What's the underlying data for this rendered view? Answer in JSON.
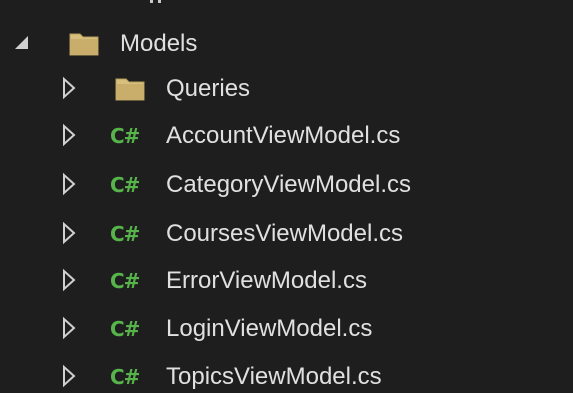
{
  "tree": {
    "root": {
      "label": "Models",
      "expanded": true,
      "icon": "folder-icon"
    },
    "children": [
      {
        "label": "Queries",
        "type": "folder",
        "icon": "folder-icon",
        "expanded": false
      },
      {
        "label": "AccountViewModel.cs",
        "type": "csharp-file",
        "badge": "C#",
        "expanded": false
      },
      {
        "label": "CategoryViewModel.cs",
        "type": "csharp-file",
        "badge": "C#",
        "expanded": false
      },
      {
        "label": "CoursesViewModel.cs",
        "type": "csharp-file",
        "badge": "C#",
        "expanded": false
      },
      {
        "label": "ErrorViewModel.cs",
        "type": "csharp-file",
        "badge": "C#",
        "expanded": false
      },
      {
        "label": "LoginViewModel.cs",
        "type": "csharp-file",
        "badge": "C#",
        "expanded": false
      },
      {
        "label": "TopicsViewModel.cs",
        "type": "csharp-file",
        "badge": "C#",
        "expanded": false
      }
    ]
  },
  "colors": {
    "background": "#1e1e1e",
    "text": "#e0e0e0",
    "folder": "#d8bf7e",
    "csharp_badge": "#57b44b",
    "expander": "#d0d0d0"
  }
}
